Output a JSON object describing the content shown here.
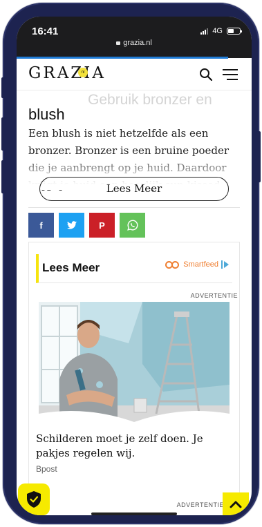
{
  "status_bar": {
    "time": "16:41",
    "network": "4G"
  },
  "browser": {
    "url": "grazia.nl"
  },
  "site": {
    "logo_text": "GRAZIA",
    "logo_suffix": "nl"
  },
  "article": {
    "ghost_heading": "Gebruik bronzer en",
    "heading": "blush",
    "body": "Een blush is niet hetzelfde als een bronzer. Bronzer is een bruine poeder die je aanbrengt op je huid. Daardoor krijgt je huid een heerlijk sun-kissed",
    "read_more_label": "Lees Meer"
  },
  "share": {
    "facebook": "f",
    "twitter": "twitter-icon",
    "pinterest": "P",
    "whatsapp": "whatsapp-icon"
  },
  "smartfeed": {
    "title": "Lees Meer",
    "brand": "Smartfeed",
    "ad_label": "ADVERTENTIE",
    "ad_caption": "Schilderen moet je zelf doen. Je pakjes regelen wij.",
    "ad_source": "Bpost",
    "ad_label_bottom": "ADVERTENTIE"
  },
  "colors": {
    "accent_yellow": "#f6ea00",
    "progress_blue": "#1f7bd6",
    "facebook": "#3b5998",
    "twitter": "#1da1f2",
    "pinterest": "#cb2027",
    "whatsapp": "#64c25a",
    "smartfeed_orange": "#ef7e30"
  },
  "icons": [
    "lock-icon",
    "signal-icon",
    "battery-icon",
    "search-icon",
    "menu-icon",
    "facebook-icon",
    "twitter-icon",
    "pinterest-icon",
    "whatsapp-icon",
    "adchoices-icon",
    "shield-icon",
    "chevron-up-icon"
  ]
}
